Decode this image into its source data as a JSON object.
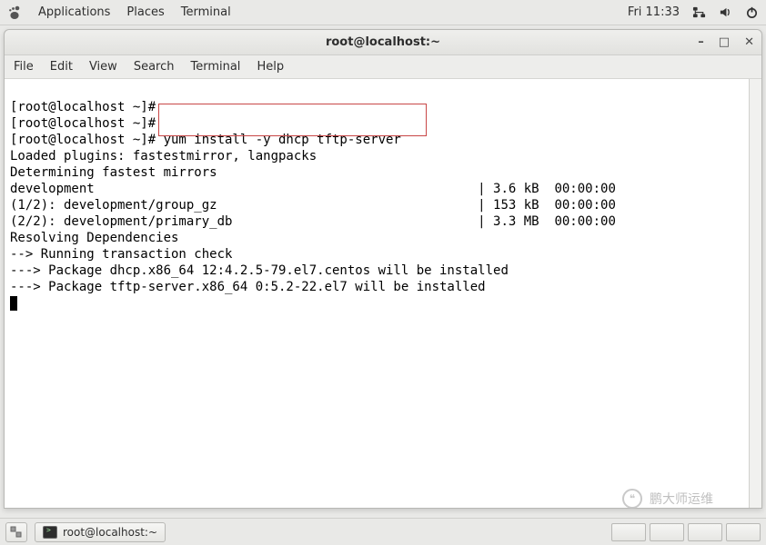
{
  "top_panel": {
    "applications": "Applications",
    "places": "Places",
    "terminal": "Terminal",
    "clock": "Fri 11:33"
  },
  "window": {
    "title": "root@localhost:~"
  },
  "menu": {
    "file": "File",
    "edit": "Edit",
    "view": "View",
    "search": "Search",
    "terminal": "Terminal",
    "help": "Help"
  },
  "terminal": {
    "lines": [
      "[root@localhost ~]#",
      "[root@localhost ~]#",
      "[root@localhost ~]# yum install -y dhcp tftp-server",
      "Loaded plugins: fastestmirror, langpacks",
      "Determining fastest mirrors",
      "development                                                  | 3.6 kB  00:00:00",
      "(1/2): development/group_gz                                  | 153 kB  00:00:00",
      "(2/2): development/primary_db                                | 3.3 MB  00:00:00",
      "Resolving Dependencies",
      "--> Running transaction check",
      "---> Package dhcp.x86_64 12:4.2.5-79.el7.centos will be installed",
      "---> Package tftp-server.x86_64 0:5.2-22.el7 will be installed"
    ]
  },
  "taskbar": {
    "task_label": "root@localhost:~"
  },
  "watermark": "鹏大师运维"
}
